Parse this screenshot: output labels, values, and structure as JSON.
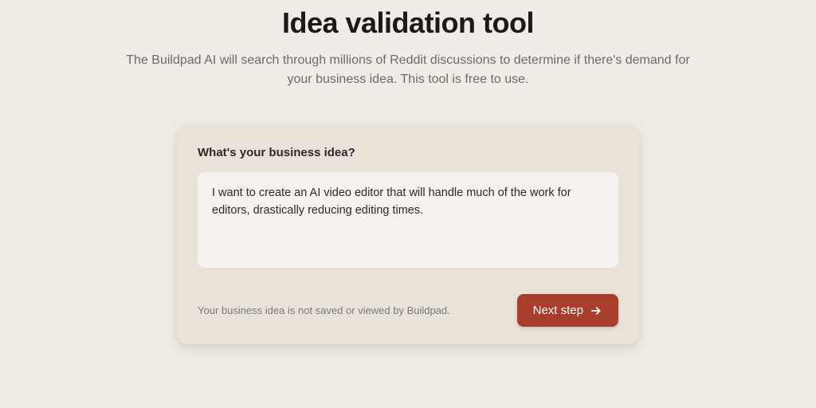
{
  "header": {
    "title": "Idea validation tool",
    "subtitle": "The Buildpad AI will search through millions of Reddit discussions to determine if there's demand for your business idea. This tool is free to use."
  },
  "form": {
    "label": "What's your business idea?",
    "idea_value": "I want to create an AI video editor that will handle much of the work for editors, drastically reducing editing times.",
    "disclaimer": "Your business idea is not saved or viewed by Buildpad.",
    "next_button_label": "Next step"
  },
  "colors": {
    "background": "#f0ece5",
    "card_bg": "#e8e2d9",
    "input_bg": "#f6f3ee",
    "button_bg": "#a73d2a"
  }
}
